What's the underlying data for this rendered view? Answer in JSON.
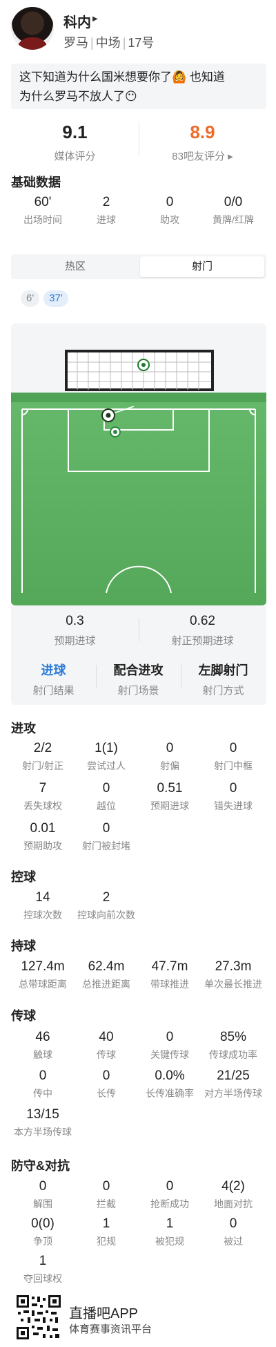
{
  "player": {
    "name": "科内",
    "team": "罗马",
    "position": "中场",
    "number": "17号"
  },
  "quote": {
    "line1": "这下知道为什么国米想要你了🙆 也知道",
    "line2": "为什么罗马不放人了😶"
  },
  "ratings": {
    "media_value": "9.1",
    "media_label": "媒体评分",
    "fan_value": "8.9",
    "fan_label": "83吧友评分 ▸"
  },
  "basic": {
    "title": "基础数据",
    "items": [
      {
        "v": "60'",
        "l": "出场时间"
      },
      {
        "v": "2",
        "l": "进球"
      },
      {
        "v": "0",
        "l": "助攻"
      },
      {
        "v": "0/0",
        "l": "黄牌/红牌"
      }
    ]
  },
  "tabs": {
    "heatmap": "热区",
    "shots": "射门"
  },
  "chips": {
    "c1": "6'",
    "c2": "37'"
  },
  "xg": {
    "xg_value": "0.3",
    "xg_label": "预期进球",
    "xgot_value": "0.62",
    "xgot_label": "射正预期进球",
    "shot1_value": "进球",
    "shot1_label": "射门结果",
    "shot2_value": "配合进攻",
    "shot2_label": "射门场景",
    "shot3_value": "左脚射门",
    "shot3_label": "射门方式"
  },
  "attack": {
    "title": "进攻",
    "rows": [
      [
        {
          "v": "2/2",
          "l": "射门/射正"
        },
        {
          "v": "1(1)",
          "l": "尝试过人"
        },
        {
          "v": "0",
          "l": "射偏"
        },
        {
          "v": "0",
          "l": "射门中框"
        }
      ],
      [
        {
          "v": "7",
          "l": "丢失球权"
        },
        {
          "v": "0",
          "l": "越位"
        },
        {
          "v": "0.51",
          "l": "预期进球"
        },
        {
          "v": "0",
          "l": "错失进球"
        }
      ],
      [
        {
          "v": "0.01",
          "l": "预期助攻"
        },
        {
          "v": "0",
          "l": "射门被封堵"
        }
      ]
    ]
  },
  "control": {
    "title": "控球",
    "rows": [
      [
        {
          "v": "14",
          "l": "控球次数"
        },
        {
          "v": "2",
          "l": "控球向前次数"
        }
      ]
    ]
  },
  "carry": {
    "title": "持球",
    "rows": [
      [
        {
          "v": "127.4m",
          "l": "总带球距离"
        },
        {
          "v": "62.4m",
          "l": "总推进距离"
        },
        {
          "v": "47.7m",
          "l": "带球推进"
        },
        {
          "v": "27.3m",
          "l": "单次最长推进"
        }
      ]
    ]
  },
  "passing": {
    "title": "传球",
    "rows": [
      [
        {
          "v": "46",
          "l": "触球"
        },
        {
          "v": "40",
          "l": "传球"
        },
        {
          "v": "0",
          "l": "关键传球"
        },
        {
          "v": "85%",
          "l": "传球成功率"
        }
      ],
      [
        {
          "v": "0",
          "l": "传中"
        },
        {
          "v": "0",
          "l": "长传"
        },
        {
          "v": "0.0%",
          "l": "长传准确率"
        },
        {
          "v": "21/25",
          "l": "对方半场传球"
        }
      ],
      [
        {
          "v": "13/15",
          "l": "本方半场传球"
        }
      ]
    ]
  },
  "defense": {
    "title": "防守&对抗",
    "rows": [
      [
        {
          "v": "0",
          "l": "解围"
        },
        {
          "v": "0",
          "l": "拦截"
        },
        {
          "v": "0",
          "l": "抢断成功"
        },
        {
          "v": "4(2)",
          "l": "地面对抗"
        }
      ],
      [
        {
          "v": "0(0)",
          "l": "争顶"
        },
        {
          "v": "1",
          "l": "犯规"
        },
        {
          "v": "1",
          "l": "被犯规"
        },
        {
          "v": "0",
          "l": "被过"
        }
      ],
      [
        {
          "v": "1",
          "l": "夺回球权"
        }
      ]
    ]
  },
  "footer": {
    "title": "直播吧APP",
    "subtitle": "体育赛事资讯平台"
  }
}
